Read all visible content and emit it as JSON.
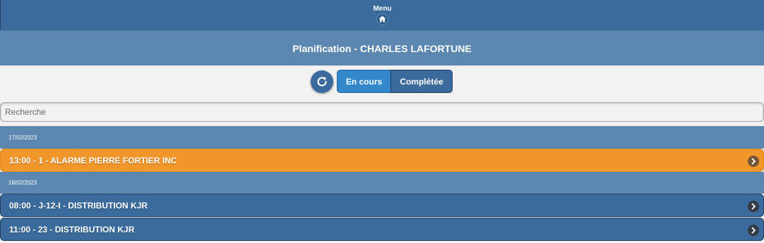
{
  "header": {
    "menu_label": "Menu"
  },
  "title": "Planification - CHARLES LAFORTUNE",
  "filter": {
    "active_label": "En cours",
    "inactive_label": "Complétée"
  },
  "search": {
    "placeholder": "Recherche",
    "value": ""
  },
  "groups": [
    {
      "date": "17/02/2023",
      "items": [
        {
          "label": "13:00 - 1 - ALARME PIERRE FORTIER INC",
          "color": "#f0962a"
        }
      ]
    },
    {
      "date": "18/02/2023",
      "items": [
        {
          "label": "08:00 - J-12-I - DISTRIBUTION KJR",
          "color": "#3a6b9c"
        },
        {
          "label": "11:00 - 23 - DISTRIBUTION KJR",
          "color": "#3a6b9c"
        }
      ]
    }
  ],
  "colors": {
    "header_bg": "#3a6b9c",
    "title_bg": "#5b87b0",
    "active_tab": "#3388cc",
    "highlight_item": "#f0962a"
  }
}
